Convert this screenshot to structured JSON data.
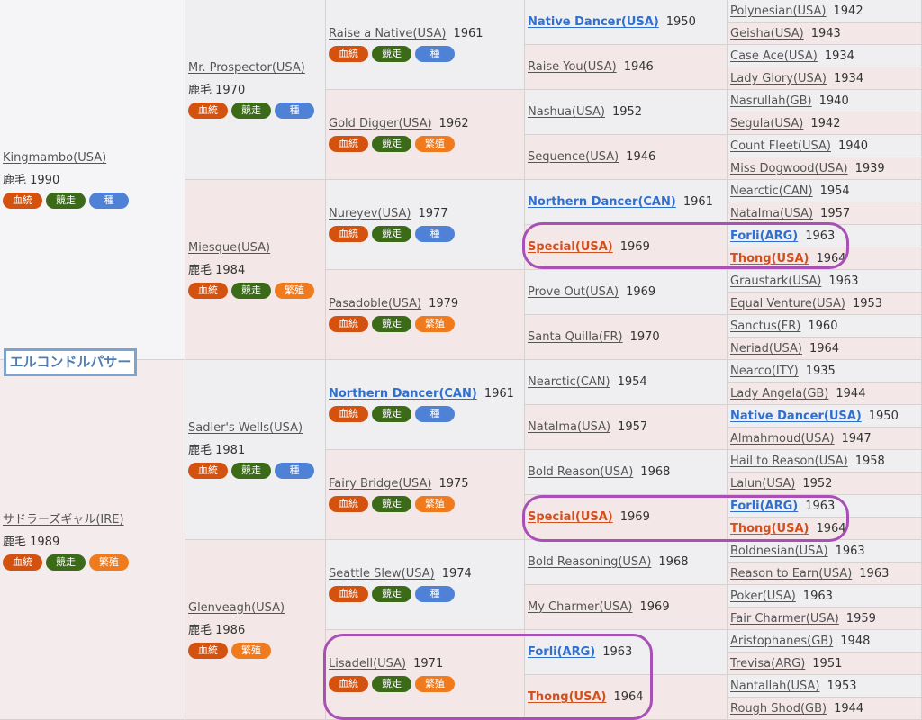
{
  "horse_name": "エルコンドルパサー",
  "coat_label": "鹿毛",
  "tag_labels": {
    "blood": "血統",
    "race": "競走",
    "sire": "種",
    "breed": "繁殖"
  },
  "gen1": [
    {
      "name": "Kingmambo(USA)",
      "coat": "鹿毛 1990",
      "tags": [
        "血統",
        "競走",
        "種"
      ]
    },
    {
      "name": "サドラーズギャル(IRE)",
      "coat": "鹿毛 1989",
      "tags": [
        "血統",
        "競走",
        "繁殖"
      ]
    }
  ],
  "gen2": [
    {
      "name": "Mr. Prospector(USA)",
      "coat": "鹿毛 1970",
      "tags": [
        "血統",
        "競走",
        "種"
      ]
    },
    {
      "name": "Miesque(USA)",
      "coat": "鹿毛 1984",
      "tags": [
        "血統",
        "競走",
        "繁殖"
      ]
    },
    {
      "name": "Sadler's Wells(USA)",
      "coat": "鹿毛 1981",
      "tags": [
        "血統",
        "競走",
        "種"
      ]
    },
    {
      "name": "Glenveagh(USA)",
      "coat": "鹿毛 1986",
      "tags": [
        "血統",
        "繁殖"
      ]
    }
  ],
  "gen3": [
    {
      "name": "Raise a Native(USA)",
      "year": "1961",
      "tags": [
        "血統",
        "競走",
        "種"
      ]
    },
    {
      "name": "Gold Digger(USA)",
      "year": "1962",
      "tags": [
        "血統",
        "競走",
        "繁殖"
      ]
    },
    {
      "name": "Nureyev(USA)",
      "year": "1977",
      "tags": [
        "血統",
        "競走",
        "種"
      ]
    },
    {
      "name": "Pasadoble(USA)",
      "year": "1979",
      "tags": [
        "血統",
        "競走",
        "繁殖"
      ]
    },
    {
      "name": "Northern Dancer(CAN)",
      "year": "1961",
      "tags": [
        "血統",
        "競走",
        "種"
      ],
      "style": "blue"
    },
    {
      "name": "Fairy Bridge(USA)",
      "year": "1975",
      "tags": [
        "血統",
        "競走",
        "繁殖"
      ]
    },
    {
      "name": "Seattle Slew(USA)",
      "year": "1974",
      "tags": [
        "血統",
        "競走",
        "種"
      ]
    },
    {
      "name": "Lisadell(USA)",
      "year": "1971",
      "tags": [
        "血統",
        "競走",
        "繁殖"
      ]
    }
  ],
  "gen4": [
    {
      "name": "Native Dancer(USA)",
      "year": "1950",
      "style": "blue"
    },
    {
      "name": "Raise You(USA)",
      "year": "1946"
    },
    {
      "name": "Nashua(USA)",
      "year": "1952"
    },
    {
      "name": "Sequence(USA)",
      "year": "1946"
    },
    {
      "name": "Northern Dancer(CAN)",
      "year": "1961",
      "style": "blue"
    },
    {
      "name": "Special(USA)",
      "year": "1969",
      "style": "red"
    },
    {
      "name": "Prove Out(USA)",
      "year": "1969"
    },
    {
      "name": "Santa Quilla(FR)",
      "year": "1970"
    },
    {
      "name": "Nearctic(CAN)",
      "year": "1954"
    },
    {
      "name": "Natalma(USA)",
      "year": "1957"
    },
    {
      "name": "Bold Reason(USA)",
      "year": "1968"
    },
    {
      "name": "Special(USA)",
      "year": "1969",
      "style": "red"
    },
    {
      "name": "Bold Reasoning(USA)",
      "year": "1968"
    },
    {
      "name": "My Charmer(USA)",
      "year": "1969"
    },
    {
      "name": "Forli(ARG)",
      "year": "1963",
      "style": "blue"
    },
    {
      "name": "Thong(USA)",
      "year": "1964",
      "style": "red"
    }
  ],
  "gen5": [
    {
      "name": "Polynesian(USA)",
      "year": "1942"
    },
    {
      "name": "Geisha(USA)",
      "year": "1943"
    },
    {
      "name": "Case Ace(USA)",
      "year": "1934"
    },
    {
      "name": "Lady Glory(USA)",
      "year": "1934"
    },
    {
      "name": "Nasrullah(GB)",
      "year": "1940"
    },
    {
      "name": "Segula(USA)",
      "year": "1942"
    },
    {
      "name": "Count Fleet(USA)",
      "year": "1940"
    },
    {
      "name": "Miss Dogwood(USA)",
      "year": "1939"
    },
    {
      "name": "Nearctic(CAN)",
      "year": "1954"
    },
    {
      "name": "Natalma(USA)",
      "year": "1957"
    },
    {
      "name": "Forli(ARG)",
      "year": "1963",
      "style": "blue"
    },
    {
      "name": "Thong(USA)",
      "year": "1964",
      "style": "red"
    },
    {
      "name": "Graustark(USA)",
      "year": "1963"
    },
    {
      "name": "Equal Venture(USA)",
      "year": "1953"
    },
    {
      "name": "Sanctus(FR)",
      "year": "1960"
    },
    {
      "name": "Neriad(USA)",
      "year": "1964"
    },
    {
      "name": "Nearco(ITY)",
      "year": "1935"
    },
    {
      "name": "Lady Angela(GB)",
      "year": "1944"
    },
    {
      "name": "Native Dancer(USA)",
      "year": "1950",
      "style": "blue"
    },
    {
      "name": "Almahmoud(USA)",
      "year": "1947"
    },
    {
      "name": "Hail to Reason(USA)",
      "year": "1958"
    },
    {
      "name": "Lalun(USA)",
      "year": "1952"
    },
    {
      "name": "Forli(ARG)",
      "year": "1963",
      "style": "blue"
    },
    {
      "name": "Thong(USA)",
      "year": "1964",
      "style": "red"
    },
    {
      "name": "Boldnesian(USA)",
      "year": "1963"
    },
    {
      "name": "Reason to Earn(USA)",
      "year": "1963"
    },
    {
      "name": "Poker(USA)",
      "year": "1963"
    },
    {
      "name": "Fair Charmer(USA)",
      "year": "1959"
    },
    {
      "name": "Aristophanes(GB)",
      "year": "1948"
    },
    {
      "name": "Trevisa(ARG)",
      "year": "1951"
    },
    {
      "name": "Nantallah(USA)",
      "year": "1953"
    },
    {
      "name": "Rough Shod(GB)",
      "year": "1944"
    }
  ],
  "colors": {
    "blood": "#d4520f",
    "race": "#3b6b18",
    "sire": "#4f82d6",
    "breed": "#f07b1e",
    "highlight": "#a850b5"
  }
}
